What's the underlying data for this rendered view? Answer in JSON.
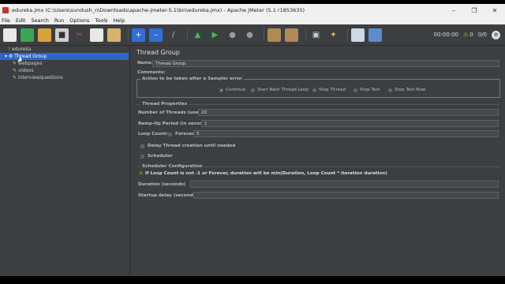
{
  "window": {
    "title": "edureka.jmx (C:\\Users\\sundush_n\\Downloads\\apache-jmeter-5.1\\bin\\edureka.jmx) - Apache JMeter (5.1 r1853635)"
  },
  "menu": [
    "File",
    "Edit",
    "Search",
    "Run",
    "Options",
    "Tools",
    "Help"
  ],
  "toolbar": {
    "icons": [
      "new-icon",
      "templates-icon",
      "open-icon",
      "save-icon",
      "cut-icon",
      "copy-icon",
      "paste-icon",
      "expand-icon",
      "collapse-icon",
      "toggle-icon",
      "start-icon",
      "start-no-pause-icon",
      "stop-icon",
      "shutdown-icon",
      "clear-icon",
      "clear-all-icon",
      "search-icon",
      "reset-search-icon",
      "function-helper-icon",
      "help-icon"
    ],
    "timer": "00:00:00",
    "warnings": "0",
    "threads": "0/0"
  },
  "tree": {
    "root": "edureka",
    "thread_group": "Thread Group",
    "children": [
      "webpages",
      "videos",
      "interviewquestions"
    ]
  },
  "panel": {
    "title": "Thread Group",
    "name_label": "Name:",
    "name_value": "Thread Group",
    "comments_label": "Comments:",
    "action_legend": "Action to be taken after a Sampler error",
    "actions": [
      "Continue",
      "Start Next Thread Loop",
      "Stop Thread",
      "Stop Test",
      "Stop Test Now"
    ],
    "selected_action": "Continue",
    "props_legend": "Thread Properties",
    "threads_label": "Number of Threads (users):",
    "threads_value": "20",
    "rampup_label": "Ramp-Up Period (in seconds):",
    "rampup_value": "1",
    "loop_label": "Loop Count:",
    "forever_label": "Forever",
    "loop_value": "5",
    "delay_label": "Delay Thread creation until needed",
    "scheduler_label": "Scheduler",
    "sched_legend": "Scheduler Configuration",
    "sched_warning": "If Loop Count is not -1 or Forever, duration will be min(Duration, Loop Count * iteration duration)",
    "duration_label": "Duration (seconds)",
    "startup_label": "Startup delay (seconds)"
  },
  "colors": {
    "selection": "#2f65ca",
    "panel_bg": "#3c3f41",
    "field_bg": "#45494a"
  }
}
